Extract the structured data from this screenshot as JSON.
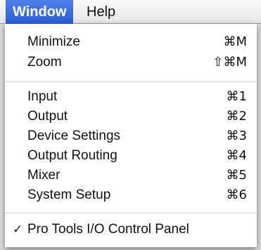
{
  "menubar": {
    "window_label": "Window",
    "help_label": "Help"
  },
  "menu": {
    "items": [
      {
        "label": "Minimize",
        "shortcut": "⌘M"
      },
      {
        "label": "Zoom",
        "shortcut": "⇧⌘M"
      },
      {
        "label": "Input",
        "shortcut": "⌘1"
      },
      {
        "label": "Output",
        "shortcut": "⌘2"
      },
      {
        "label": "Device Settings",
        "shortcut": "⌘3"
      },
      {
        "label": "Output Routing",
        "shortcut": "⌘4"
      },
      {
        "label": "Mixer",
        "shortcut": "⌘5"
      },
      {
        "label": "System Setup",
        "shortcut": "⌘6"
      },
      {
        "label": "Pro Tools I/O Control Panel",
        "checked": true,
        "check_mark": "✓"
      }
    ]
  }
}
